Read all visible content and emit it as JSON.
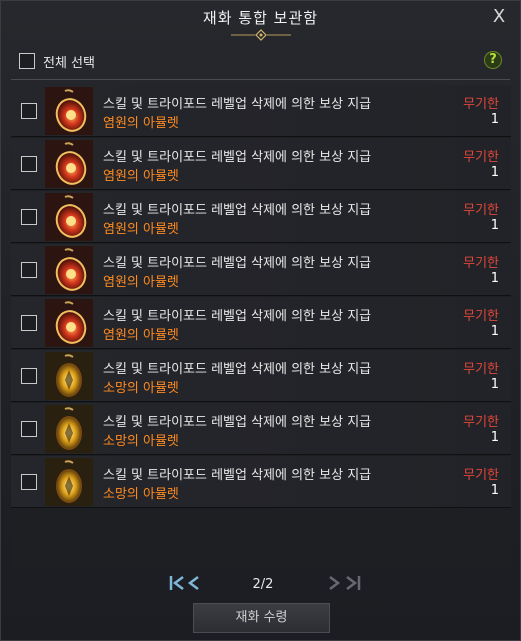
{
  "window": {
    "title": "재화 통합 보관함",
    "close_glyph": "X"
  },
  "select_all": {
    "label": "전체 선택"
  },
  "help": {
    "glyph": "?"
  },
  "items": [
    {
      "line1": "스킬 및 트라이포드 레벨업 삭제에 의한 보상 지급",
      "name": "염원의 아뮬렛",
      "bind": "무기한",
      "qty": "1",
      "icon": "red-amulet-icon"
    },
    {
      "line1": "스킬 및 트라이포드 레벨업 삭제에 의한 보상 지급",
      "name": "염원의 아뮬렛",
      "bind": "무기한",
      "qty": "1",
      "icon": "red-amulet-icon"
    },
    {
      "line1": "스킬 및 트라이포드 레벨업 삭제에 의한 보상 지급",
      "name": "염원의 아뮬렛",
      "bind": "무기한",
      "qty": "1",
      "icon": "red-amulet-icon"
    },
    {
      "line1": "스킬 및 트라이포드 레벨업 삭제에 의한 보상 지급",
      "name": "염원의 아뮬렛",
      "bind": "무기한",
      "qty": "1",
      "icon": "red-amulet-icon"
    },
    {
      "line1": "스킬 및 트라이포드 레벨업 삭제에 의한 보상 지급",
      "name": "염원의 아뮬렛",
      "bind": "무기한",
      "qty": "1",
      "icon": "red-amulet-icon"
    },
    {
      "line1": "스킬 및 트라이포드 레벨업 삭제에 의한 보상 지급",
      "name": "소망의 아뮬렛",
      "bind": "무기한",
      "qty": "1",
      "icon": "gold-amulet-icon"
    },
    {
      "line1": "스킬 및 트라이포드 레벨업 삭제에 의한 보상 지급",
      "name": "소망의 아뮬렛",
      "bind": "무기한",
      "qty": "1",
      "icon": "gold-amulet-icon"
    },
    {
      "line1": "스킬 및 트라이포드 레벨업 삭제에 의한 보상 지급",
      "name": "소망의 아뮬렛",
      "bind": "무기한",
      "qty": "1",
      "icon": "gold-amulet-icon"
    }
  ],
  "pagination": {
    "first": "K",
    "prev": "<",
    "next": ">",
    "last": ">I",
    "page": "2/2"
  },
  "receive_button": {
    "label": "재화 수령"
  },
  "colors": {
    "item_name": "#ff8a1f",
    "bind_text": "#e0463a",
    "pager_active": "#7eb6d8",
    "pager_disabled": "#666a70"
  }
}
